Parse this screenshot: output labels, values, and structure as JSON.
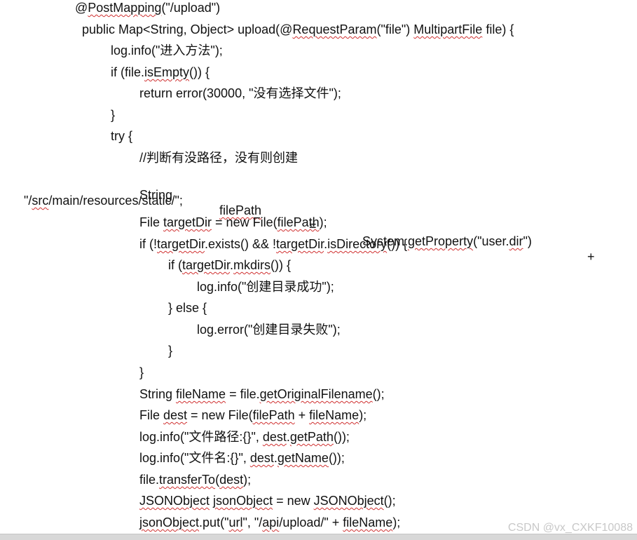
{
  "code": {
    "l1": {
      "a": "@",
      "b": "PostMapping",
      "c": "(\"/upload\")"
    },
    "l2": {
      "a": "public Map<String, Object> upload(@",
      "b": "RequestParam",
      "c": "(\"file\") ",
      "d": "MultipartFile",
      "e": " file) {"
    },
    "l3": {
      "a": "log.info(\"进入方法\");"
    },
    "l4": {
      "a": "if (file.",
      "b": "isEmpty",
      "c": "()) {"
    },
    "l5": {
      "a": "return error(30000, \"没有选择文件\");"
    },
    "l6": {
      "a": "}"
    },
    "l7": {
      "a": "try {"
    },
    "l8": {
      "a": "//判断有没路径，没有则创建"
    },
    "l9": {
      "a": "String",
      "b": "filePath",
      "c": "=",
      "d": "System.",
      "e": "getProperty",
      "f": "(\"user.",
      "g": "dir",
      "h": "\")",
      "i": "+"
    },
    "l10": {
      "a": "\"/",
      "b": "src",
      "c": "/main/resources/static/\";"
    },
    "l11": {
      "a": "File ",
      "b": "targetDir",
      "c": " = new File(",
      "d": "filePath",
      "e": ");"
    },
    "l12": {
      "a": "if (!",
      "b": "targetDir",
      "c": ".exists() && !",
      "d": "targetDir",
      "e": ".",
      "f": "isDirectory",
      "g": "()) {"
    },
    "l13": {
      "a": "if (",
      "b": "targetDir",
      "c": ".",
      "d": "mkdirs",
      "e": "()) {"
    },
    "l14": {
      "a": "log.info(\"创建目录成功\");"
    },
    "l15": {
      "a": "} else {"
    },
    "l16": {
      "a": "log.error(\"创建目录失败\");"
    },
    "l17": {
      "a": "}"
    },
    "l18": {
      "a": "}"
    },
    "l19": {
      "a": "String ",
      "b": "fileName",
      "c": " = file.",
      "d": "getOriginalFilename",
      "e": "();"
    },
    "l20": {
      "a": "File ",
      "b": "dest",
      "c": " = new File(",
      "d": "filePath",
      "e": " + ",
      "f": "fileName",
      "g": ");"
    },
    "l21": {
      "a": "log.info(\"文件路径:{}\", ",
      "b": "dest",
      "c": ".",
      "d": "getPath",
      "e": "());"
    },
    "l22": {
      "a": "log.info(\"文件名:{}\", ",
      "b": "dest",
      "c": ".",
      "d": "getName",
      "e": "());"
    },
    "l23": {
      "a": "file.",
      "b": "transferTo",
      "c": "(",
      "d": "dest",
      "e": ");"
    },
    "l24": {
      "a": "JSONObject",
      "b": " ",
      "c": "jsonObject",
      "d": " = new ",
      "e": "JSONObject",
      "f": "();"
    },
    "l25": {
      "a": "jsonObject",
      "b": ".put(\"",
      "c": "url",
      "d": "\", \"/",
      "e": "api",
      "f": "/upload/\" + ",
      "g": "fileName",
      "h": ");"
    }
  },
  "watermark": "CSDN @vx_CXKF10088"
}
